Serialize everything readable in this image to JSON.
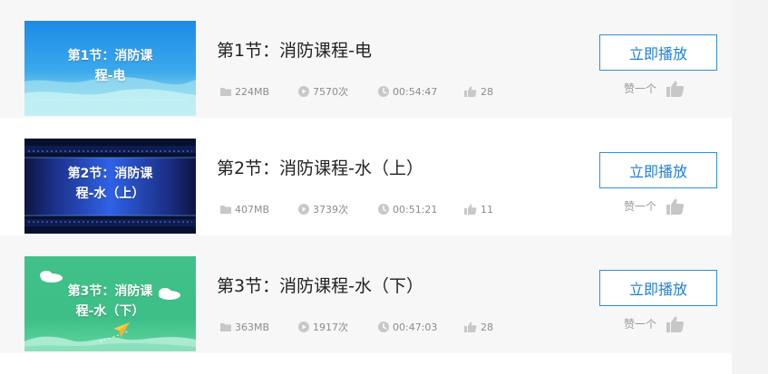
{
  "lessons": [
    {
      "title": "第1节：消防课程-电",
      "thumbnail_lines": [
        "第1节：消防课",
        "程-电"
      ],
      "size": "224MB",
      "plays": "7570次",
      "duration": "00:54:47",
      "likes": "28",
      "play_label": "立即播放",
      "like_label": "赞一个",
      "thumbnail_theme": "blue-water",
      "thumbnail_colors": [
        "#1c88e6",
        "#8fd6ef"
      ]
    },
    {
      "title": "第2节：消防课程-水（上）",
      "thumbnail_lines": [
        "第2节：消防课",
        "程-水（上）"
      ],
      "size": "407MB",
      "plays": "3739次",
      "duration": "00:51:21",
      "likes": "11",
      "play_label": "立即播放",
      "like_label": "赞一个",
      "thumbnail_theme": "dark-blue-tech",
      "thumbnail_colors": [
        "#09143d",
        "#1d44c9"
      ]
    },
    {
      "title": "第3节：消防课程-水（下）",
      "thumbnail_lines": [
        "第3节：消防课",
        "程-水（下）"
      ],
      "size": "363MB",
      "plays": "1917次",
      "duration": "00:47:03",
      "likes": "28",
      "play_label": "立即播放",
      "like_label": "赞一个",
      "thumbnail_theme": "green-cartoon",
      "thumbnail_colors": [
        "#3dc18a",
        "#8de0b3"
      ]
    }
  ],
  "colors": {
    "accent": "#2f8ee0",
    "title_text": "#222222",
    "meta_text": "#8c8c8c",
    "row_alt_bg": "#f7f7f7",
    "gutter_bg": "#f3f3f3"
  },
  "icons": {
    "size": "folder-icon",
    "plays": "play-circle-icon",
    "duration": "clock-icon",
    "likes": "thumbs-up-icon",
    "like_button": "thumbs-up-icon"
  }
}
